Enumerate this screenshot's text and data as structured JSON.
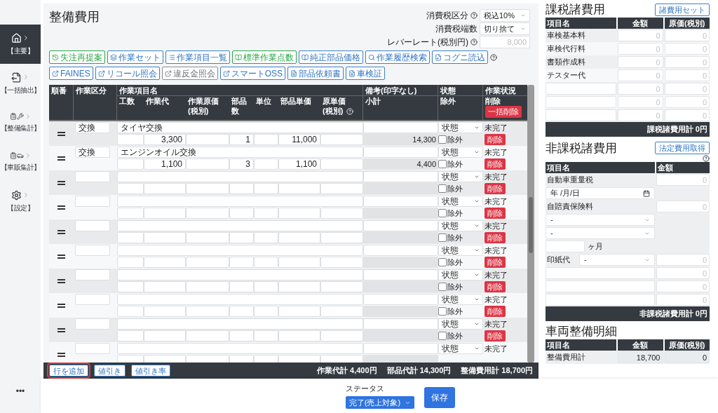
{
  "sidebar": {
    "items": [
      {
        "label": "【主要】",
        "selected": true
      },
      {
        "label": "【一括抽出】",
        "selected": false
      },
      {
        "label": "【整備集計】",
        "selected": false
      },
      {
        "label": "【車販集計】",
        "selected": false
      },
      {
        "label": "【設定】",
        "selected": false
      }
    ],
    "more": "•••"
  },
  "main": {
    "title": "整備費用",
    "tax_settings": [
      {
        "label": "消費税区分",
        "help": true,
        "kind": "select",
        "value": "税込10%"
      },
      {
        "label": "消費税端数",
        "kind": "select",
        "value": "切り捨て"
      },
      {
        "label": "レバーレート(税別円)",
        "help": true,
        "kind": "input",
        "placeholder": "8,000"
      }
    ],
    "toolbar": [
      [
        {
          "label": "失注再提案",
          "kind": "retry",
          "disabled": false
        },
        {
          "label": "作業セット",
          "kind": "set",
          "disabled": false
        },
        {
          "label": "作業項目一覧",
          "kind": "list",
          "disabled": false
        },
        {
          "label": "標準作業点数",
          "kind": "standard",
          "disabled": false
        },
        {
          "label": "純正部品価格",
          "kind": "parts",
          "disabled": false
        },
        {
          "label": "作業履歴検索",
          "kind": "search",
          "disabled": false
        },
        {
          "label": "コグニ読込",
          "kind": "import",
          "disabled": false
        }
      ],
      [
        {
          "label": "FAINES",
          "kind": "external",
          "disabled": false
        },
        {
          "label": "リコール照会",
          "kind": "external",
          "disabled": false
        },
        {
          "label": "違反金照会",
          "kind": "external",
          "disabled": true
        },
        {
          "label": "スマートOSS",
          "kind": "external",
          "disabled": false
        },
        {
          "label": "部品依頼書",
          "kind": "pdf",
          "disabled": false
        },
        {
          "label": "車検証",
          "kind": "pdf",
          "disabled": false
        }
      ]
    ],
    "toolbar_help": true,
    "table": {
      "header": {
        "top": [
          "順番",
          "作業区分",
          "作業項目名",
          "備考(印字なし)",
          "状態",
          "作業状況"
        ],
        "sub": [
          {
            "label": "工数"
          },
          {
            "label": "作業代"
          },
          {
            "label": "作業原価\n(税別)"
          },
          {
            "label": "部品数"
          },
          {
            "label": "単位"
          },
          {
            "label": "部品単価"
          },
          {
            "label": "原単価\n(税別)",
            "help": true
          },
          {
            "label": "小計"
          },
          {
            "label": "除外"
          },
          {
            "label": "削除"
          }
        ],
        "bulk_delete": "一括削除"
      },
      "rows": [
        {
          "kubun": "交換",
          "name": "タイヤ交換",
          "sagyo_dai": "3,300",
          "buhin_su": "1",
          "buhin_tanka": "11,000",
          "subtotal": "14,300",
          "status_select": "状態",
          "status_text": "未完了",
          "exclude": {
            "label": "除外",
            "checked": false
          },
          "delete_label": "削除"
        },
        {
          "kubun": "交換",
          "name": "エンジンオイル交換",
          "sagyo_dai": "1,100",
          "buhin_su": "3",
          "buhin_tanka": "1,100",
          "subtotal": "4,400",
          "status_select": "状態",
          "status_text": "未完了",
          "exclude": {
            "label": "除外",
            "checked": false
          },
          "delete_label": "削除"
        },
        {
          "status_select": "状態",
          "status_text": "未完了",
          "exclude": {
            "label": "除外",
            "checked": false
          },
          "delete_label": "削除"
        },
        {
          "status_select": "状態",
          "status_text": "未完了",
          "exclude": {
            "label": "除外",
            "checked": false
          },
          "delete_label": "削除"
        },
        {
          "status_select": "状態",
          "status_text": "未完了",
          "exclude": {
            "label": "除外",
            "checked": false
          },
          "delete_label": "削除"
        },
        {
          "status_select": "状態",
          "status_text": "未完了",
          "exclude": {
            "label": "除外",
            "checked": false
          },
          "delete_label": "削除"
        },
        {
          "status_select": "状態",
          "status_text": "未完了",
          "exclude": {
            "label": "除外",
            "checked": false
          },
          "delete_label": "削除"
        },
        {
          "status_select": "状態",
          "status_text": "未完了",
          "exclude": {
            "label": "除外",
            "checked": false
          },
          "delete_label": "削除"
        },
        {
          "status_select": "状態",
          "status_text": "未完了",
          "exclude": {
            "label": "除外",
            "checked": false
          },
          "delete_label": "削除"
        },
        {
          "status_select": "状態",
          "status_text": "未完了"
        }
      ]
    },
    "bottom_bar": {
      "buttons": [
        {
          "label": "行を追加",
          "highlighted": true
        },
        {
          "label": "値引き",
          "highlighted": false
        },
        {
          "label": "値引き率",
          "highlighted": false
        }
      ],
      "totals": [
        "作業代計 4,400円",
        "部品代計 14,300円",
        "整備費用計 18,700円"
      ]
    }
  },
  "taxable": {
    "title": "課税諸費用",
    "button": "諸費用セット",
    "columns": [
      "項目名",
      "金額",
      "原価(税別)"
    ],
    "rows": [
      {
        "name": "車検基本料",
        "amount_placeholder": "0",
        "cost_placeholder": "0"
      },
      {
        "name": "車検代行料",
        "amount_placeholder": "0",
        "cost_placeholder": "0"
      },
      {
        "name": "書類作成料",
        "amount_placeholder": "0",
        "cost_placeholder": "0"
      },
      {
        "name": "テスター代",
        "amount_placeholder": "0",
        "cost_placeholder": "0"
      },
      {
        "amount_placeholder": "0",
        "cost_placeholder": "0"
      },
      {
        "amount_placeholder": "0",
        "cost_placeholder": "0"
      },
      {
        "amount_placeholder": "0",
        "cost_placeholder": "0"
      }
    ],
    "total": "課税諸費用計 0円"
  },
  "nontaxable": {
    "title": "非課税諸費用",
    "button": "法定費用取得",
    "help": true,
    "columns": [
      "項目名",
      "金額"
    ],
    "rows": [
      {
        "kind": "label",
        "name": "自動車重量税",
        "amount_placeholder": "0"
      },
      {
        "kind": "date",
        "placeholder": "年 /月/日"
      },
      {
        "kind": "label",
        "name": "自賠責保険料",
        "amount_placeholder": "0"
      },
      {
        "kind": "select",
        "value": "-"
      },
      {
        "kind": "select",
        "value": "-"
      },
      {
        "kind": "months",
        "unit": "ヶ月"
      },
      {
        "kind": "label_select",
        "name": "印紙代",
        "stamp_value": "-",
        "amount_placeholder": "0"
      },
      {
        "kind": "input",
        "amount_placeholder": "0"
      },
      {
        "kind": "input",
        "amount_placeholder": "0"
      },
      {
        "kind": "input",
        "amount_placeholder": "0"
      }
    ],
    "total": "非課税諸費用計 0円"
  },
  "vehicle_detail": {
    "title": "車両整備明細",
    "columns": [
      "項目名",
      "金額",
      "原価(税別)"
    ],
    "rows": [
      {
        "name": "整備費用計",
        "amount": "18,700",
        "cost": "0"
      }
    ]
  },
  "footer": {
    "status_label": "ステータス",
    "status_value": "完了(売上対象)",
    "save": "保存"
  }
}
